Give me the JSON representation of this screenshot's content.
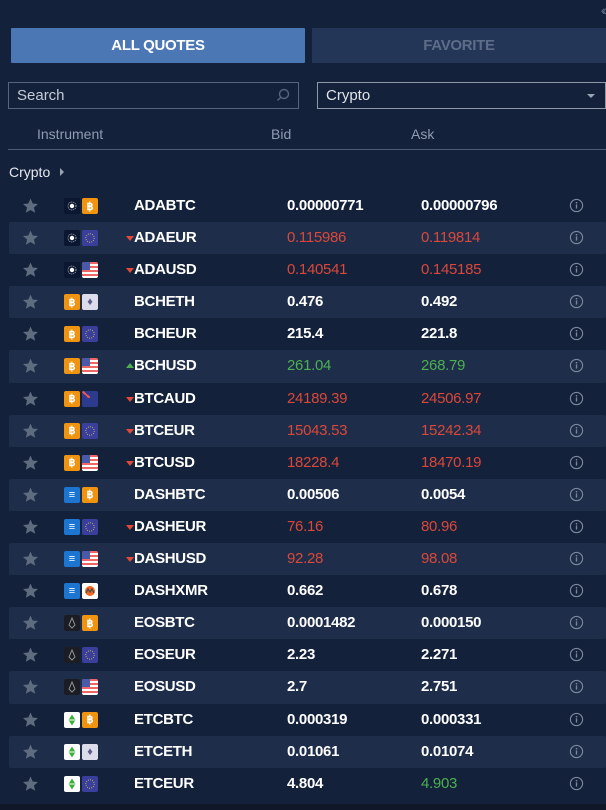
{
  "panel": {
    "collapse_icon": "double-chevron-left-icon"
  },
  "tabs": [
    {
      "label": "ALL QUOTES",
      "active": true
    },
    {
      "label": "FAVORITE",
      "active": false
    }
  ],
  "search": {
    "placeholder": "Search",
    "value": ""
  },
  "category_select": {
    "value": "Crypto"
  },
  "columns": {
    "instrument": "Instrument",
    "bid": "Bid",
    "ask": "Ask"
  },
  "group": {
    "label": "Crypto"
  },
  "colors": {
    "up": "#4caf50",
    "down": "#d9483a",
    "accent": "#4b78b5"
  },
  "rows": [
    {
      "name": "ADABTC",
      "base": "ada",
      "quote": "btc",
      "dir": "",
      "bid": "0.00000771",
      "ask": "0.00000796",
      "bid_color": "",
      "ask_color": ""
    },
    {
      "name": "ADAEUR",
      "base": "ada",
      "quote": "eur",
      "dir": "down",
      "bid": "0.115986",
      "ask": "0.119814",
      "bid_color": "red",
      "ask_color": "red"
    },
    {
      "name": "ADAUSD",
      "base": "ada",
      "quote": "usd",
      "dir": "down",
      "bid": "0.140541",
      "ask": "0.145185",
      "bid_color": "red",
      "ask_color": "red"
    },
    {
      "name": "BCHETH",
      "base": "btc",
      "quote": "eth",
      "dir": "",
      "bid": "0.476",
      "ask": "0.492",
      "bid_color": "",
      "ask_color": ""
    },
    {
      "name": "BCHEUR",
      "base": "btc",
      "quote": "eur",
      "dir": "",
      "bid": "215.4",
      "ask": "221.8",
      "bid_color": "",
      "ask_color": ""
    },
    {
      "name": "BCHUSD",
      "base": "btc",
      "quote": "usd",
      "dir": "up",
      "bid": "261.04",
      "ask": "268.79",
      "bid_color": "green",
      "ask_color": "green"
    },
    {
      "name": "BTCAUD",
      "base": "btc",
      "quote": "aud",
      "dir": "down",
      "bid": "24189.39",
      "ask": "24506.97",
      "bid_color": "red",
      "ask_color": "red"
    },
    {
      "name": "BTCEUR",
      "base": "btc",
      "quote": "eur",
      "dir": "down",
      "bid": "15043.53",
      "ask": "15242.34",
      "bid_color": "red",
      "ask_color": "red"
    },
    {
      "name": "BTCUSD",
      "base": "btc",
      "quote": "usd",
      "dir": "down",
      "bid": "18228.4",
      "ask": "18470.19",
      "bid_color": "red",
      "ask_color": "red"
    },
    {
      "name": "DASHBTC",
      "base": "dash",
      "quote": "btc",
      "dir": "",
      "bid": "0.00506",
      "ask": "0.0054",
      "bid_color": "",
      "ask_color": ""
    },
    {
      "name": "DASHEUR",
      "base": "dash",
      "quote": "eur",
      "dir": "down",
      "bid": "76.16",
      "ask": "80.96",
      "bid_color": "red",
      "ask_color": "red"
    },
    {
      "name": "DASHUSD",
      "base": "dash",
      "quote": "usd",
      "dir": "down",
      "bid": "92.28",
      "ask": "98.08",
      "bid_color": "red",
      "ask_color": "red"
    },
    {
      "name": "DASHXMR",
      "base": "dash",
      "quote": "xmr",
      "dir": "",
      "bid": "0.662",
      "ask": "0.678",
      "bid_color": "",
      "ask_color": ""
    },
    {
      "name": "EOSBTC",
      "base": "eos",
      "quote": "btc",
      "dir": "",
      "bid": "0.0001482",
      "ask": "0.000150",
      "bid_color": "",
      "ask_color": ""
    },
    {
      "name": "EOSEUR",
      "base": "eos",
      "quote": "eur",
      "dir": "",
      "bid": "2.23",
      "ask": "2.271",
      "bid_color": "",
      "ask_color": ""
    },
    {
      "name": "EOSUSD",
      "base": "eos",
      "quote": "usd",
      "dir": "",
      "bid": "2.7",
      "ask": "2.751",
      "bid_color": "",
      "ask_color": ""
    },
    {
      "name": "ETCBTC",
      "base": "etc",
      "quote": "btc",
      "dir": "",
      "bid": "0.000319",
      "ask": "0.000331",
      "bid_color": "",
      "ask_color": ""
    },
    {
      "name": "ETCETH",
      "base": "etc",
      "quote": "eth",
      "dir": "",
      "bid": "0.01061",
      "ask": "0.01074",
      "bid_color": "",
      "ask_color": ""
    },
    {
      "name": "ETCEUR",
      "base": "etc",
      "quote": "eur",
      "dir": "",
      "bid": "4.804",
      "ask": "4.903",
      "bid_color": "",
      "ask_color": "green"
    }
  ]
}
